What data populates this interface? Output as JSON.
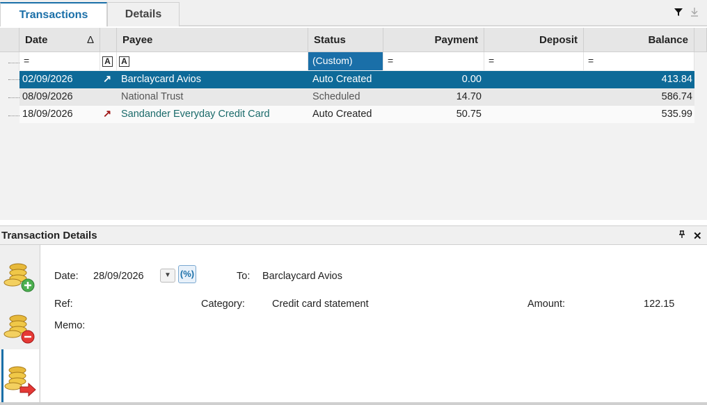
{
  "tabs": [
    {
      "label": "Transactions",
      "active": true
    },
    {
      "label": "Details",
      "active": false
    }
  ],
  "toolbar": {
    "filter_icon": "funnel-icon",
    "export_icon": "download-icon"
  },
  "columns": {
    "date": "Date",
    "sort_indicator": "Δ",
    "payee": "Payee",
    "status": "Status",
    "payment": "Payment",
    "deposit": "Deposit",
    "balance": "Balance"
  },
  "filter_row": {
    "date": "=",
    "payee_a1": "A",
    "payee_a2": "A",
    "status": "(Custom)",
    "payment": "=",
    "deposit": "=",
    "balance": "="
  },
  "rows": [
    {
      "date": "02/09/2026",
      "icon": "↗",
      "payee": "Barclaycard Avios",
      "status": "Auto Created",
      "payment": "0.00",
      "deposit": "",
      "balance": "413.84",
      "selected": true
    },
    {
      "date": "08/09/2026",
      "icon": "",
      "payee": "National Trust",
      "status": "Scheduled",
      "payment": "14.70",
      "deposit": "",
      "balance": "586.74"
    },
    {
      "date": "18/09/2026",
      "icon": "↗",
      "payee": "Sandander Everyday Credit Card",
      "status": "Auto Created",
      "payment": "50.75",
      "deposit": "",
      "balance": "535.99"
    }
  ],
  "details_panel": {
    "title": "Transaction Details",
    "pin_icon": "pin-icon",
    "close_icon": "close-icon",
    "date_label": "Date:",
    "date_value": "28/09/2026",
    "to_label": "To:",
    "to_value": "Barclaycard Avios",
    "ref_label": "Ref:",
    "category_label": "Category:",
    "category_value": "Credit card statement",
    "amount_label": "Amount:",
    "amount_value": "122.15",
    "memo_label": "Memo:"
  },
  "sidebar": [
    {
      "name": "add-deposit-icon"
    },
    {
      "name": "add-payment-icon"
    },
    {
      "name": "transfer-icon",
      "active": true
    }
  ]
}
